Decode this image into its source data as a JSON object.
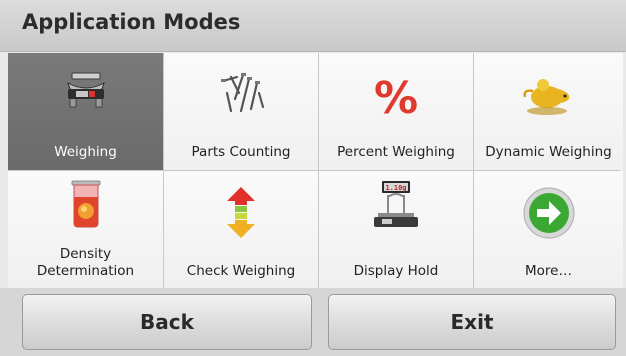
{
  "header": {
    "title": "Application Modes"
  },
  "modes": [
    {
      "label": "Weighing",
      "icon": "scale-pan-icon",
      "selected": true
    },
    {
      "label": "Parts Counting",
      "icon": "nails-icon",
      "selected": false
    },
    {
      "label": "Percent Weighing",
      "icon": "percent-icon",
      "selected": false
    },
    {
      "label": "Dynamic Weighing",
      "icon": "mouse-icon",
      "selected": false
    },
    {
      "label": "Density\nDetermination",
      "icon": "beaker-icon",
      "selected": false
    },
    {
      "label": "Check Weighing",
      "icon": "up-down-arrows-icon",
      "selected": false
    },
    {
      "label": "Display Hold",
      "icon": "display-hold-scale-icon",
      "selected": false,
      "display_value": "1.10g"
    },
    {
      "label": "More…",
      "icon": "right-arrow-circle-icon",
      "selected": false
    }
  ],
  "footer": {
    "back_label": "Back",
    "exit_label": "Exit"
  },
  "colors": {
    "selected_tile": "#6f6f6f",
    "percent": "#e03a2f",
    "arrow_green": "#3aa832"
  }
}
